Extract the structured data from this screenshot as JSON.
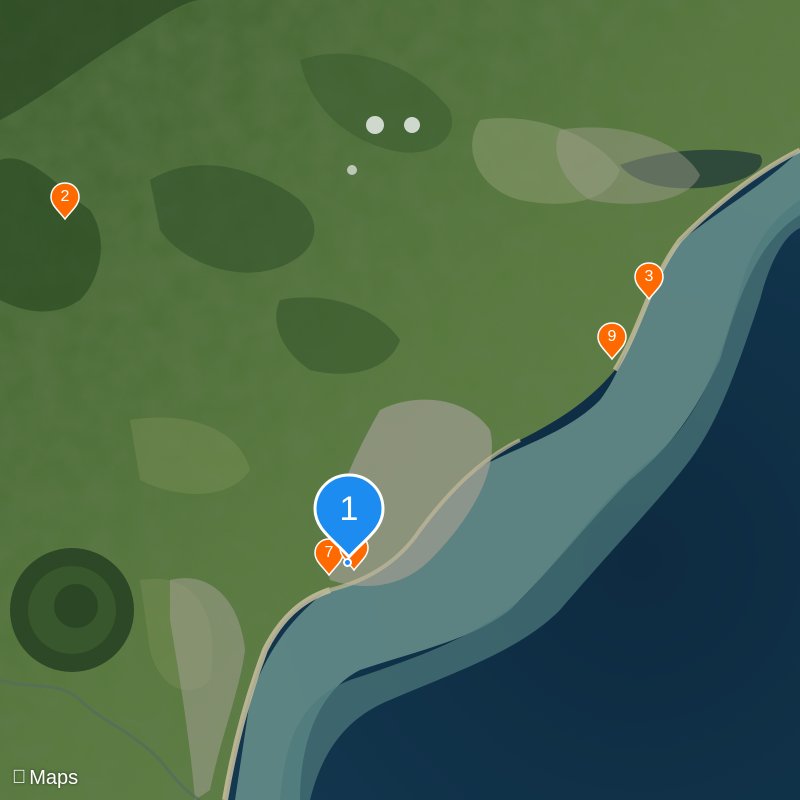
{
  "map": {
    "type": "satellite",
    "colors": {
      "land_dark": "#2c4a23",
      "land_mid": "#4a6b35",
      "land_light": "#6f8a52",
      "water_deep": "#10304a",
      "water_shallow": "#6f9691",
      "beach": "#c9bd9a",
      "urban": "#9a9a8e",
      "pin": "#ff6a00",
      "cluster": "#1d8cf0"
    }
  },
  "pins": [
    {
      "id": "2",
      "label": "2"
    },
    {
      "id": "3",
      "label": "3"
    },
    {
      "id": "9",
      "label": "9"
    },
    {
      "id": "7",
      "label": "7"
    }
  ],
  "cluster": {
    "label": "1"
  },
  "attribution": {
    "icon": "apple-logo-icon",
    "label": "Maps"
  }
}
